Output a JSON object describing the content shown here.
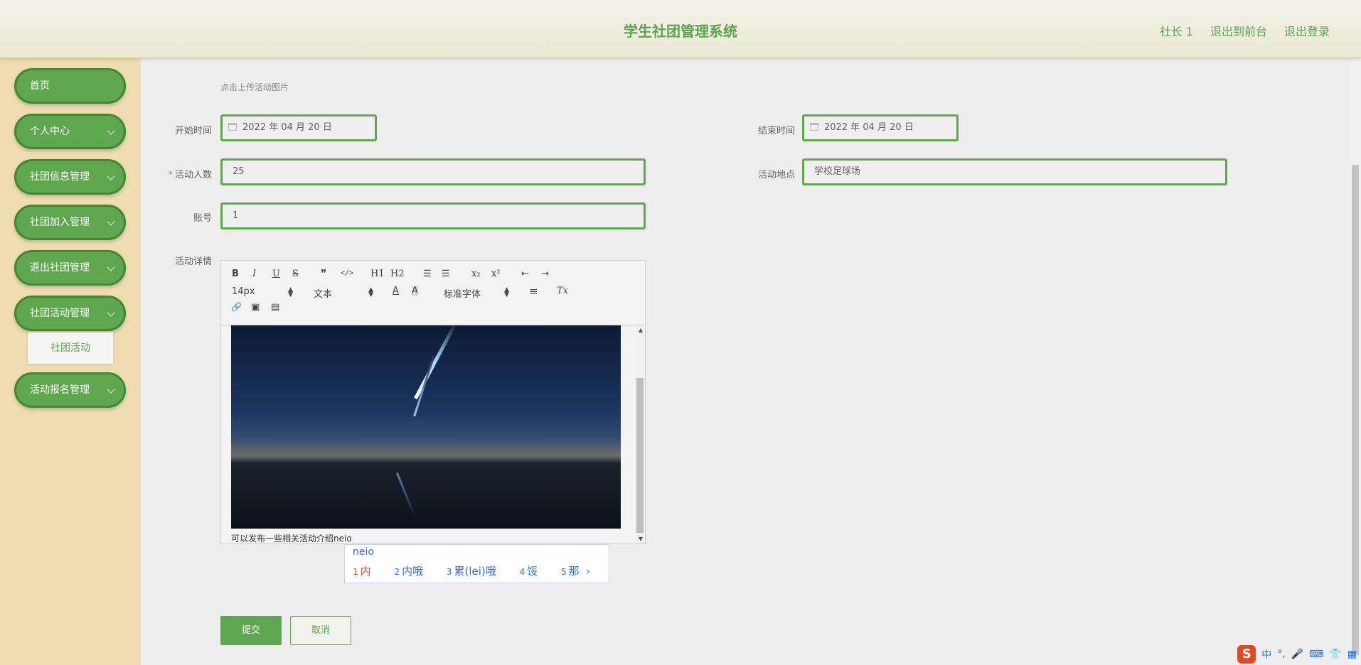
{
  "header": {
    "title": "学生社团管理系统",
    "links": [
      "社长 1",
      "退出到前台",
      "退出登录"
    ]
  },
  "sidebar": {
    "items": [
      {
        "label": "首页"
      },
      {
        "label": "个人中心"
      },
      {
        "label": "社团信息管理"
      },
      {
        "label": "社团加入管理"
      },
      {
        "label": "退出社团管理"
      },
      {
        "label": "社团活动管理"
      },
      {
        "label": "活动报名管理"
      }
    ],
    "submenu_label": "社团活动"
  },
  "form": {
    "upload_hint": "点击上传活动图片",
    "start_label": "开始时间",
    "start_value": "2022 年 04 月 20 日",
    "end_label": "结束时间",
    "end_value": "2022 年 04 月 20 日",
    "count_label": "活动人数",
    "count_value": "25",
    "place_label": "活动地点",
    "place_value": "学校足球场",
    "account_label": "账号",
    "account_value": "1",
    "detail_label": "活动详情",
    "required_mark": "*"
  },
  "editor": {
    "toolbar": {
      "bold": "B",
      "italic": "I",
      "underline": "U",
      "strike": "S",
      "quote": "❞",
      "code": "</>",
      "h1": "H1",
      "h2": "H2",
      "ordered": "☰",
      "bullet": "☰",
      "sub": "x₂",
      "sup": "x²",
      "outdent": "⇤",
      "indent": "⇥",
      "size_value": "14px",
      "header_value": "文本",
      "color": "A",
      "background": "A",
      "font_value": "标准字体",
      "align": "≡",
      "clean": "Tx",
      "link": "🔗",
      "image": "▣",
      "video": "▤"
    },
    "caption_text": "可以发布一些相关活动介绍neio"
  },
  "ime": {
    "input": "neio",
    "candidates": [
      {
        "num": "1",
        "text": "内"
      },
      {
        "num": "2",
        "text": "内哦"
      },
      {
        "num": "3",
        "text": "累(lei)哦"
      },
      {
        "num": "4",
        "text": "馁"
      },
      {
        "num": "5",
        "text": "那"
      }
    ],
    "prev": "‹",
    "next": "›"
  },
  "buttons": {
    "submit": "提交",
    "cancel": "取消"
  },
  "tray": {
    "s": "S",
    "lang": "中",
    "punct": "°,",
    "mic": "🎤",
    "keyboard": "⌨",
    "skin": "👕",
    "grid": "▦"
  },
  "colors": {
    "accent": "#5fa74f",
    "sidebar_bg": "#efdcb0",
    "title": "#5ea353"
  }
}
